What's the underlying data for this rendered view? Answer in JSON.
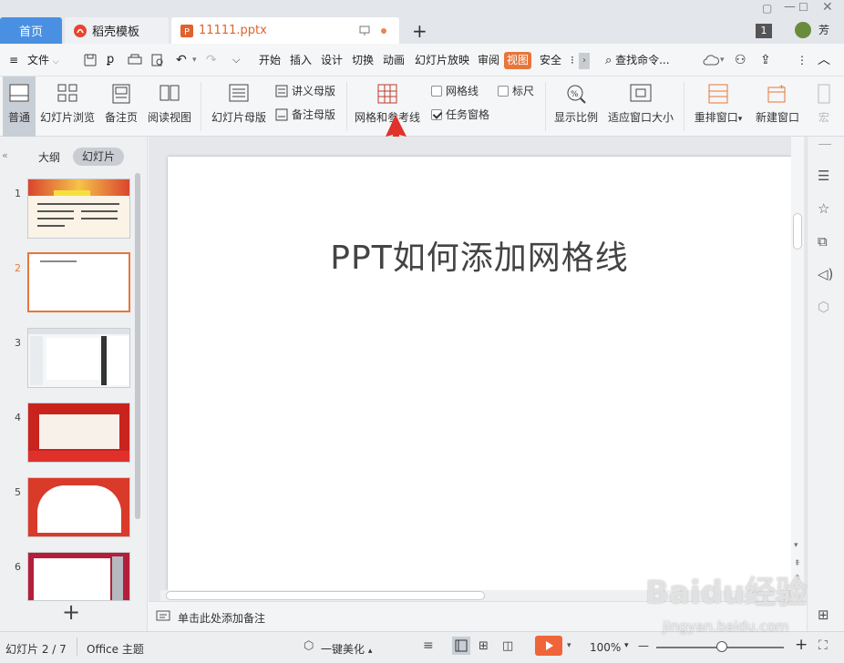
{
  "tabs": {
    "home": "首页",
    "template": "稻壳模板",
    "file": "11111.pptx",
    "add": "+"
  },
  "window": {
    "badge": "1",
    "user": "芳"
  },
  "menubar": {
    "file_label": "文件",
    "items": [
      "开始",
      "插入",
      "设计",
      "切换",
      "动画",
      "幻灯片放映",
      "审阅",
      "视图",
      "安全"
    ],
    "active": "视图",
    "search_placeholder": "查找命令..."
  },
  "ribbon": {
    "normal": "普通",
    "slide_sorter": "幻灯片浏览",
    "notes_page": "备注页",
    "reading_view": "阅读视图",
    "slide_master": "幻灯片母版",
    "handout_master": "讲义母版",
    "notes_master": "备注母版",
    "grid_guides": "网格和参考线",
    "gridlines": "网格线",
    "ruler": "标尺",
    "task_pane": "任务窗格",
    "zoom": "显示比例",
    "fit_window": "适应窗口大小",
    "arrange": "重排窗口",
    "new_window": "新建窗口",
    "macro": "宏",
    "gridlines_checked": false,
    "ruler_checked": false,
    "task_pane_checked": true
  },
  "sidebar": {
    "outline_tab": "大纲",
    "slides_tab": "幻灯片",
    "slide_numbers": [
      "1",
      "2",
      "3",
      "4",
      "5",
      "6"
    ],
    "selected": "2",
    "add": "+"
  },
  "slide": {
    "title": "PPT如何添加网格线"
  },
  "notes": {
    "placeholder": "单击此处添加备注"
  },
  "status": {
    "slide_count": "幻灯片 2 / 7",
    "theme": "Office 主题",
    "beautify": "一键美化",
    "zoom": "100%",
    "minus": "—",
    "plus": "+"
  },
  "watermark": {
    "brand": "Baidu经验",
    "url": "jingyan.baidu.com"
  },
  "colors": {
    "accent": "#e6763b",
    "home_tab": "#4a90e2",
    "arrow": "#e0312a"
  }
}
